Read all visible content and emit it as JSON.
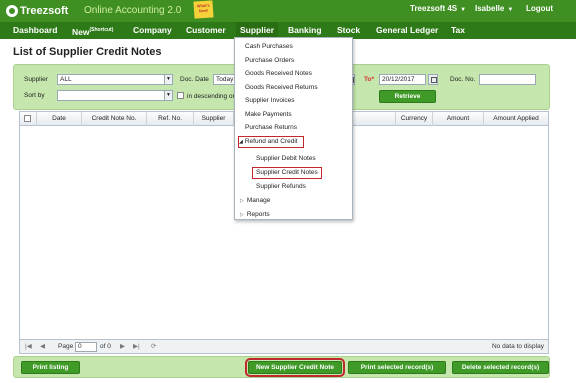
{
  "header": {
    "brand": "Treezsoft",
    "product": "Online Accounting 2.0",
    "whats_new": "What's New!",
    "company": "Treezsoft 4S",
    "user": "Isabelle",
    "logout": "Logout"
  },
  "nav": {
    "dashboard": "Dashboard",
    "new": "New",
    "new_sup": "(Shortcut)",
    "company": "Company",
    "customer": "Customer",
    "supplier": "Supplier",
    "banking": "Banking",
    "stock": "Stock",
    "general_ledger": "General Ledger",
    "tax": "Tax"
  },
  "page": {
    "title": "List of Supplier Credit Notes"
  },
  "filter": {
    "supplier_label": "Supplier",
    "supplier_value": "ALL",
    "doc_date_label": "Doc. Date",
    "doc_date_value": "Today",
    "to_label": "To",
    "to_required": "*",
    "to_value": "20/12/2017",
    "doc_no_label": "Doc. No.",
    "doc_no_value": "",
    "sort_label": "Sort by",
    "sort_value": "",
    "descending_label": "in descending or",
    "retrieve": "Retrieve"
  },
  "grid": {
    "columns": [
      "Date",
      "Credit Note No.",
      "Ref. No.",
      "Supplier",
      "Currency",
      "Amount",
      "Amount Applied"
    ],
    "page_label": "Page",
    "page_value": "0",
    "of_label": "of 0",
    "no_data": "No data to display"
  },
  "actions": {
    "print_listing": "Print listing",
    "new_credit_note": "New Supplier Credit Note",
    "print_selected": "Print selected record(s)",
    "delete_selected": "Delete selected record(s)"
  },
  "supplier_menu": {
    "cash_purchases": "Cash Purchases",
    "purchase_orders": "Purchase Orders",
    "goods_received_notes": "Goods Received Notes",
    "goods_received_returns": "Goods Received Returns",
    "supplier_invoices": "Supplier Invoices",
    "make_payments": "Make Payments",
    "purchase_returns": "Purchase Returns",
    "refund_and_credit": "Refund and Credit",
    "supplier_debit_notes": "Supplier Debit Notes",
    "supplier_credit_notes": "Supplier Credit Notes",
    "supplier_refunds": "Supplier Refunds",
    "manage": "Manage",
    "reports": "Reports"
  },
  "icons": {
    "dropdown_arrow": "chevron-down-icon",
    "calendar": "calendar-icon",
    "expanded": "triangle-down-icon",
    "collapsed": "triangle-right-icon"
  },
  "colors": {
    "header_green": "#3f8f22",
    "nav_green": "#2e7a18",
    "panel_green": "#c5e6ad",
    "button_green": "#3f9a28",
    "highlight_red": "#c0282d"
  }
}
